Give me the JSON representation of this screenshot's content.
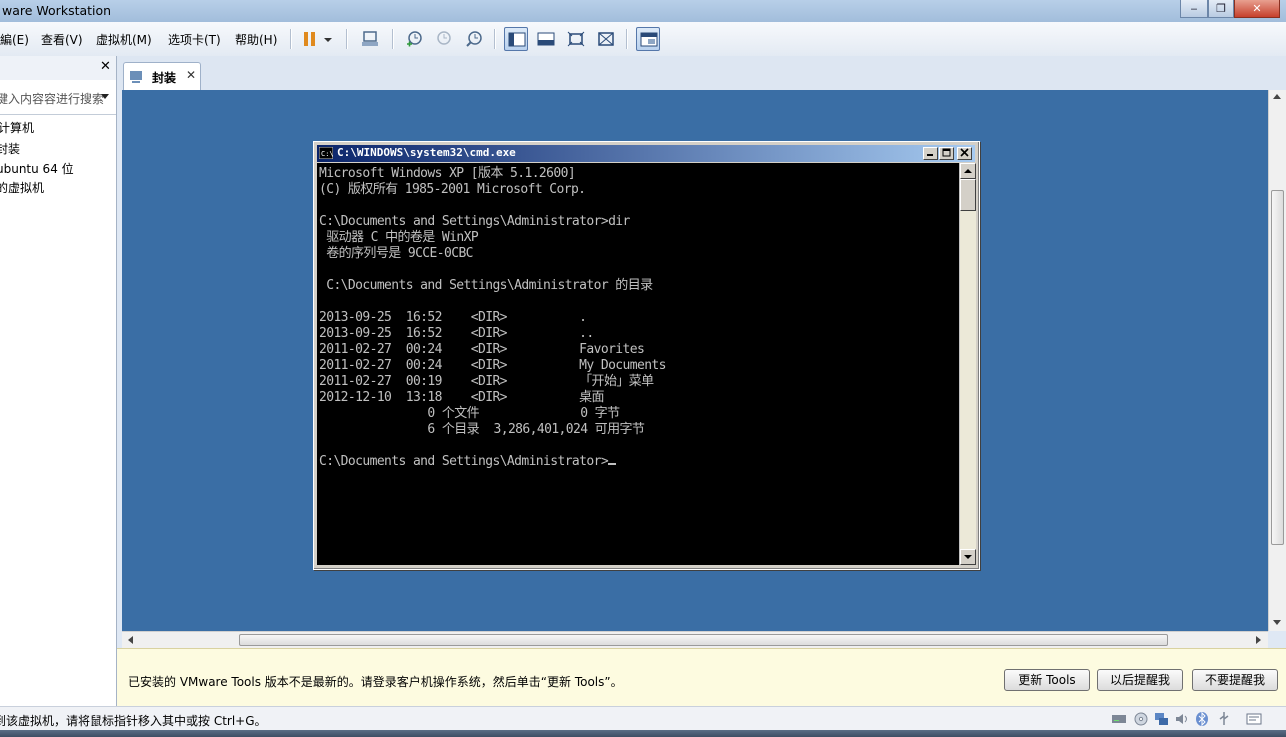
{
  "window": {
    "title": "ware Workstation",
    "buttons": [
      "‒",
      "❐",
      "✕"
    ]
  },
  "menu": [
    "編(E)",
    "查看(V)",
    "虚拟机(M)",
    "选项卡(T)",
    "帮助(H)"
  ],
  "toolbar": {
    "icons": [
      "pause-icon",
      "dropdown-icon",
      "send-ctrl-alt-del-icon",
      "snapshot-take-icon",
      "snapshot-revert-icon",
      "snapshot-manager-icon",
      "show-library-icon",
      "show-thumbnail-icon",
      "fullscreen-icon",
      "unity-icon",
      "console-view-icon"
    ]
  },
  "library": {
    "close": "✕",
    "search_placeholder": "键入内容容进行搜索",
    "items": [
      "计算机",
      "封装",
      "ubuntu 64 位",
      "的虚拟机"
    ]
  },
  "tab": {
    "label": "封装",
    "close": "✕"
  },
  "cmd": {
    "title": "C:\\WINDOWS\\system32\\cmd.exe",
    "lines": [
      "Microsoft Windows XP [版本 5.1.2600]",
      "(C) 版权所有 1985-2001 Microsoft Corp.",
      "",
      "C:\\Documents and Settings\\Administrator>dir",
      " 驱动器 C 中的卷是 WinXP",
      " 卷的序列号是 9CCE-0CBC",
      "",
      " C:\\Documents and Settings\\Administrator 的目录",
      "",
      "2013-09-25  16:52    <DIR>          .",
      "2013-09-25  16:52    <DIR>          ..",
      "2011-02-27  00:24    <DIR>          Favorites",
      "2011-02-27  00:24    <DIR>          My Documents",
      "2011-02-27  00:19    <DIR>          「开始」菜单",
      "2012-12-10  13:18    <DIR>          桌面",
      "               0 个文件              0 字节",
      "               6 个目录  3,286,401,024 可用字节",
      "",
      "C:\\Documents and Settings\\Administrator>"
    ]
  },
  "infobar": {
    "message": "已安装的 VMware Tools 版本不是最新的。请登录客户机操作系统，然后单击“更新 Tools”。",
    "buttons": [
      "更新 Tools",
      "以后提醒我",
      "不要提醒我"
    ]
  },
  "status": {
    "text": "到该虚拟机，请将鼠标指针移入其中或按 Ctrl+G。",
    "icons": [
      "hard-disk-icon",
      "cd-icon",
      "network-icon",
      "sound-icon",
      "bluetooth-icon",
      "usb-icon",
      "message-icon"
    ]
  },
  "colors": {
    "vm_background": "#3a6ea5",
    "titlebar": "#a2bddb",
    "cmd_titlebar": "#0a246a",
    "infobar": "#fdfbe0"
  }
}
